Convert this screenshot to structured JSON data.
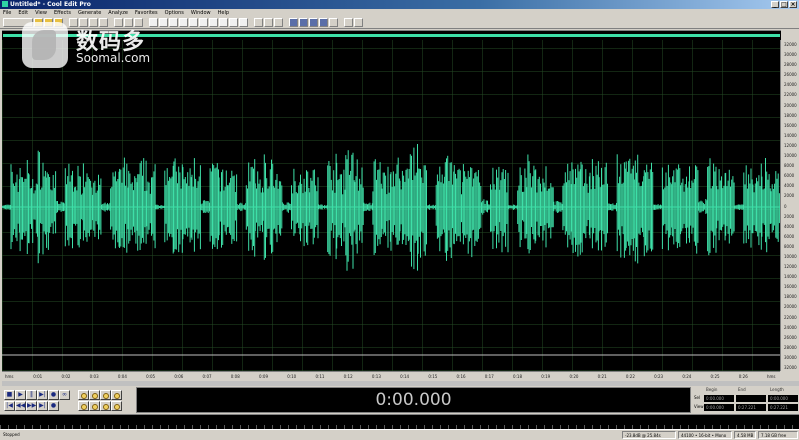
{
  "window": {
    "title": "Untitled* - Cool Edit Pro",
    "buttons": [
      "_",
      "□",
      "×"
    ]
  },
  "menu": [
    "File",
    "Edit",
    "View",
    "Effects",
    "Generate",
    "Analyze",
    "Favorites",
    "Options",
    "Window",
    "Help"
  ],
  "watermark": {
    "cn": "数码多",
    "en": "Soomal.com"
  },
  "colors": {
    "waveform": "#3ee0a8",
    "background": "#000000",
    "grid": "#224622"
  },
  "amplitude_labels": [
    "32000",
    "30000",
    "28000",
    "26000",
    "24000",
    "22000",
    "20000",
    "18000",
    "16000",
    "14000",
    "12000",
    "10000",
    "8000",
    "6000",
    "4000",
    "2000",
    "0",
    "2000",
    "4000",
    "6000",
    "8000",
    "10000",
    "12000",
    "14000",
    "16000",
    "18000",
    "20000",
    "22000",
    "24000",
    "26000",
    "28000",
    "30000",
    "32000"
  ],
  "time_labels": [
    "hms",
    "0:01",
    "0:02",
    "0:03",
    "0:04",
    "0:05",
    "0:06",
    "0:07",
    "0:08",
    "0:09",
    "0:10",
    "0:11",
    "0:12",
    "0:13",
    "0:14",
    "0:15",
    "0:16",
    "0:17",
    "0:18",
    "0:19",
    "0:20",
    "0:21",
    "0:22",
    "0:23",
    "0:24",
    "0:25",
    "0:26",
    "hms"
  ],
  "transport": {
    "row1": [
      "■",
      "▶",
      "‖",
      "▶|",
      "●",
      "∞"
    ],
    "row2": [
      "|◀",
      "◀◀",
      "▶▶",
      "▶|",
      "●"
    ]
  },
  "time_display": "0:00.000",
  "selection": {
    "headers": [
      "Begin",
      "End",
      "Length"
    ],
    "rows": [
      {
        "label": "Sel",
        "begin": "0:00.000",
        "end": "",
        "length": "0:00.000"
      },
      {
        "label": "View",
        "begin": "0:00.000",
        "end": "0:27.221",
        "length": "0:27.221"
      }
    ]
  },
  "status": {
    "left": "Stopped",
    "fields": [
      "-23.8dB @ 25.84s",
      "44100 • 16-bit • Mono",
      "4.58 MB",
      "7.18 GB free"
    ]
  },
  "waveform_envelope": [
    0.02,
    0.3,
    0.35,
    0.25,
    0.38,
    0.28,
    0.04,
    0.32,
    0.27,
    0.36,
    0.22,
    0.03,
    0.3,
    0.34,
    0.26,
    0.31,
    0.29,
    0.02,
    0.37,
    0.33,
    0.28,
    0.36,
    0.05,
    0.33,
    0.27,
    0.3,
    0.03,
    0.35,
    0.25,
    0.38,
    0.22,
    0.04,
    0.28,
    0.31,
    0.26,
    0.02,
    0.34,
    0.3,
    0.45,
    0.33,
    0.03,
    0.32,
    0.28,
    0.35,
    0.3,
    0.55,
    0.34,
    0.02,
    0.31,
    0.36,
    0.29,
    0.33,
    0.27,
    0.05,
    0.3,
    0.32,
    0.02,
    0.26,
    0.34,
    0.31,
    0.28,
    0.04,
    0.33,
    0.37,
    0.29,
    0.35,
    0.3,
    0.03,
    0.36,
    0.31,
    0.42,
    0.33,
    0.02,
    0.3,
    0.34,
    0.28,
    0.32,
    0.05,
    0.37,
    0.3,
    0.26,
    0.02,
    0.33,
    0.28,
    0.31,
    0.29
  ]
}
